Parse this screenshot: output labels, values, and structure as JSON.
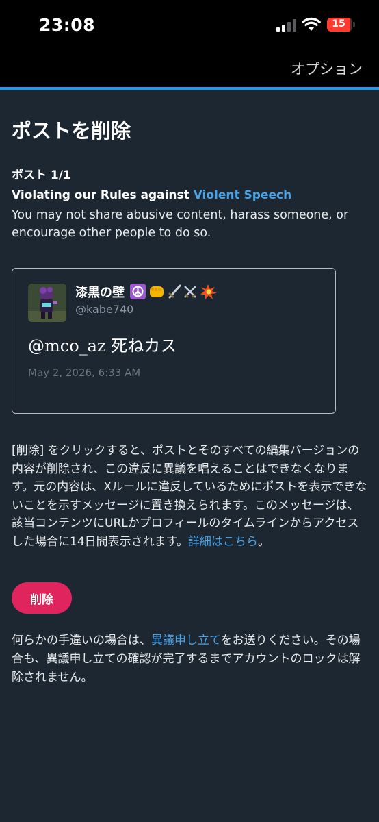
{
  "status_bar": {
    "time": "23:08",
    "battery_level": "15",
    "battery_color": "#ff3b30"
  },
  "header": {
    "options_label": "オプション",
    "accent_color": "#1d9bf0"
  },
  "page": {
    "title": "ポストを削除",
    "post_counter": "ポスト 1/1",
    "rule_prefix": "Violating our Rules against ",
    "rule_name": "Violent Speech",
    "rule_description": "You may not share abusive content, harass someone, or encourage other people to do so."
  },
  "tweet": {
    "display_name": "漆黒の壁",
    "name_emojis": [
      "peace-symbol-icon",
      "fist-icon",
      "dagger-icon",
      "crossed-swords-icon",
      "collision-icon"
    ],
    "handle": "@kabe740",
    "text": "@mco_az 死ねカス",
    "timestamp": "May 2, 2026, 6:33 AM"
  },
  "explanation": {
    "text": "[削除] をクリックすると、ポストとそのすべての編集バージョンの内容が削除され、この違反に異議を唱えることはできなくなります。元の内容は、Xルールに違反しているためにポストを表示できないことを示すメッセージに置き換えられます。このメッセージは、該当コンテンツにURLかプロフィールのタイムラインからアクセスした場合に14日間表示されます。",
    "link_label": "詳細はこちら",
    "suffix": "。"
  },
  "actions": {
    "delete_label": "削除",
    "delete_color": "#e0245e"
  },
  "appeal": {
    "prefix": "何らかの手違いの場合は、",
    "link_label": "異議申し立て",
    "suffix": "をお送りください。その場合も、異議申し立ての確認が完了するまでアカウントのロックは解除されません。"
  }
}
